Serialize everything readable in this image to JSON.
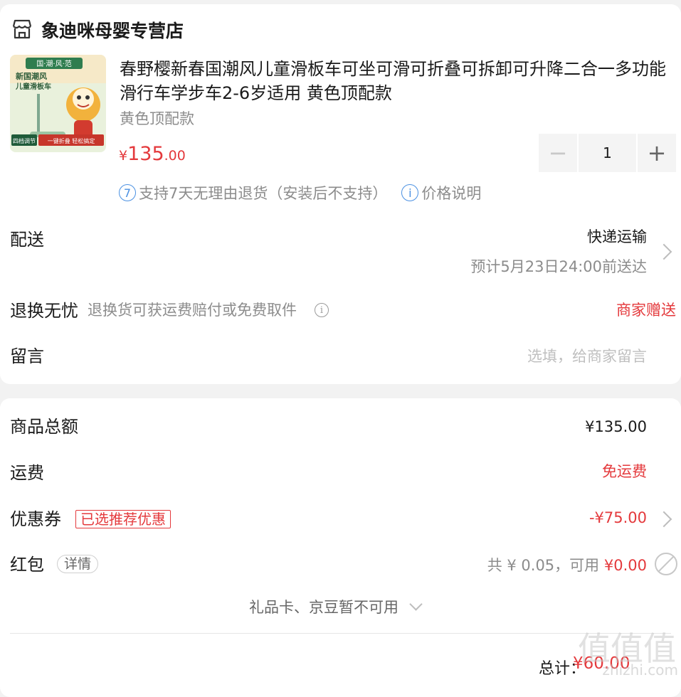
{
  "shop": {
    "name": "象迪咪母婴专营店",
    "icon": "store-icon"
  },
  "product": {
    "image_text_top": "国·潮·风·范",
    "image_text_title": "新国潮风\n儿童滑板车",
    "image_badge_left": "四档调节",
    "image_badge_right": "一键折叠 轻松搞定",
    "title": "春野樱新春国潮风儿童滑板车可坐可滑可折叠可拆卸可升降二合一多功能滑行车学步车2-6岁适用 黄色顶配款",
    "spec": "黄色顶配款",
    "price_symbol": "¥",
    "price_int": "135",
    "price_dec": ".00",
    "quantity": "1",
    "minus": "−",
    "plus": "+",
    "policy_badge": "7",
    "policy_text": "支持7天无理由退货（安装后不支持）",
    "price_note_badge": "i",
    "price_note": "价格说明"
  },
  "delivery": {
    "label": "配送",
    "method": "快递运输",
    "eta": "预计5月23日24:00前送达"
  },
  "return_worry_free": {
    "label": "退换无忧",
    "desc": "退换货可获运费赔付或免费取件",
    "info_badge": "i",
    "value": "商家赠送"
  },
  "message": {
    "label": "留言",
    "placeholder": "选填，给商家留言"
  },
  "summary": {
    "goods_total_label": "商品总额",
    "goods_total_value": "¥135.00",
    "shipping_label": "运费",
    "shipping_value": "免运费",
    "coupon_label": "优惠券",
    "coupon_tag": "已选推荐优惠",
    "coupon_value": "-¥75.00",
    "redpacket_label": "红包",
    "redpacket_detail": "详情",
    "redpacket_available_text": "共 ¥ 0.05，可用",
    "redpacket_value": "¥0.00",
    "giftcard_text": "礼品卡、京豆暂不可用",
    "total_label": "总计：",
    "total_value": "¥60.00"
  },
  "watermark": {
    "text": "zhizhi.com",
    "glyphs": "值值值"
  },
  "colors": {
    "accent_red": "#e4393c",
    "info_blue": "#4a90e2",
    "muted": "#8c8c8c"
  }
}
